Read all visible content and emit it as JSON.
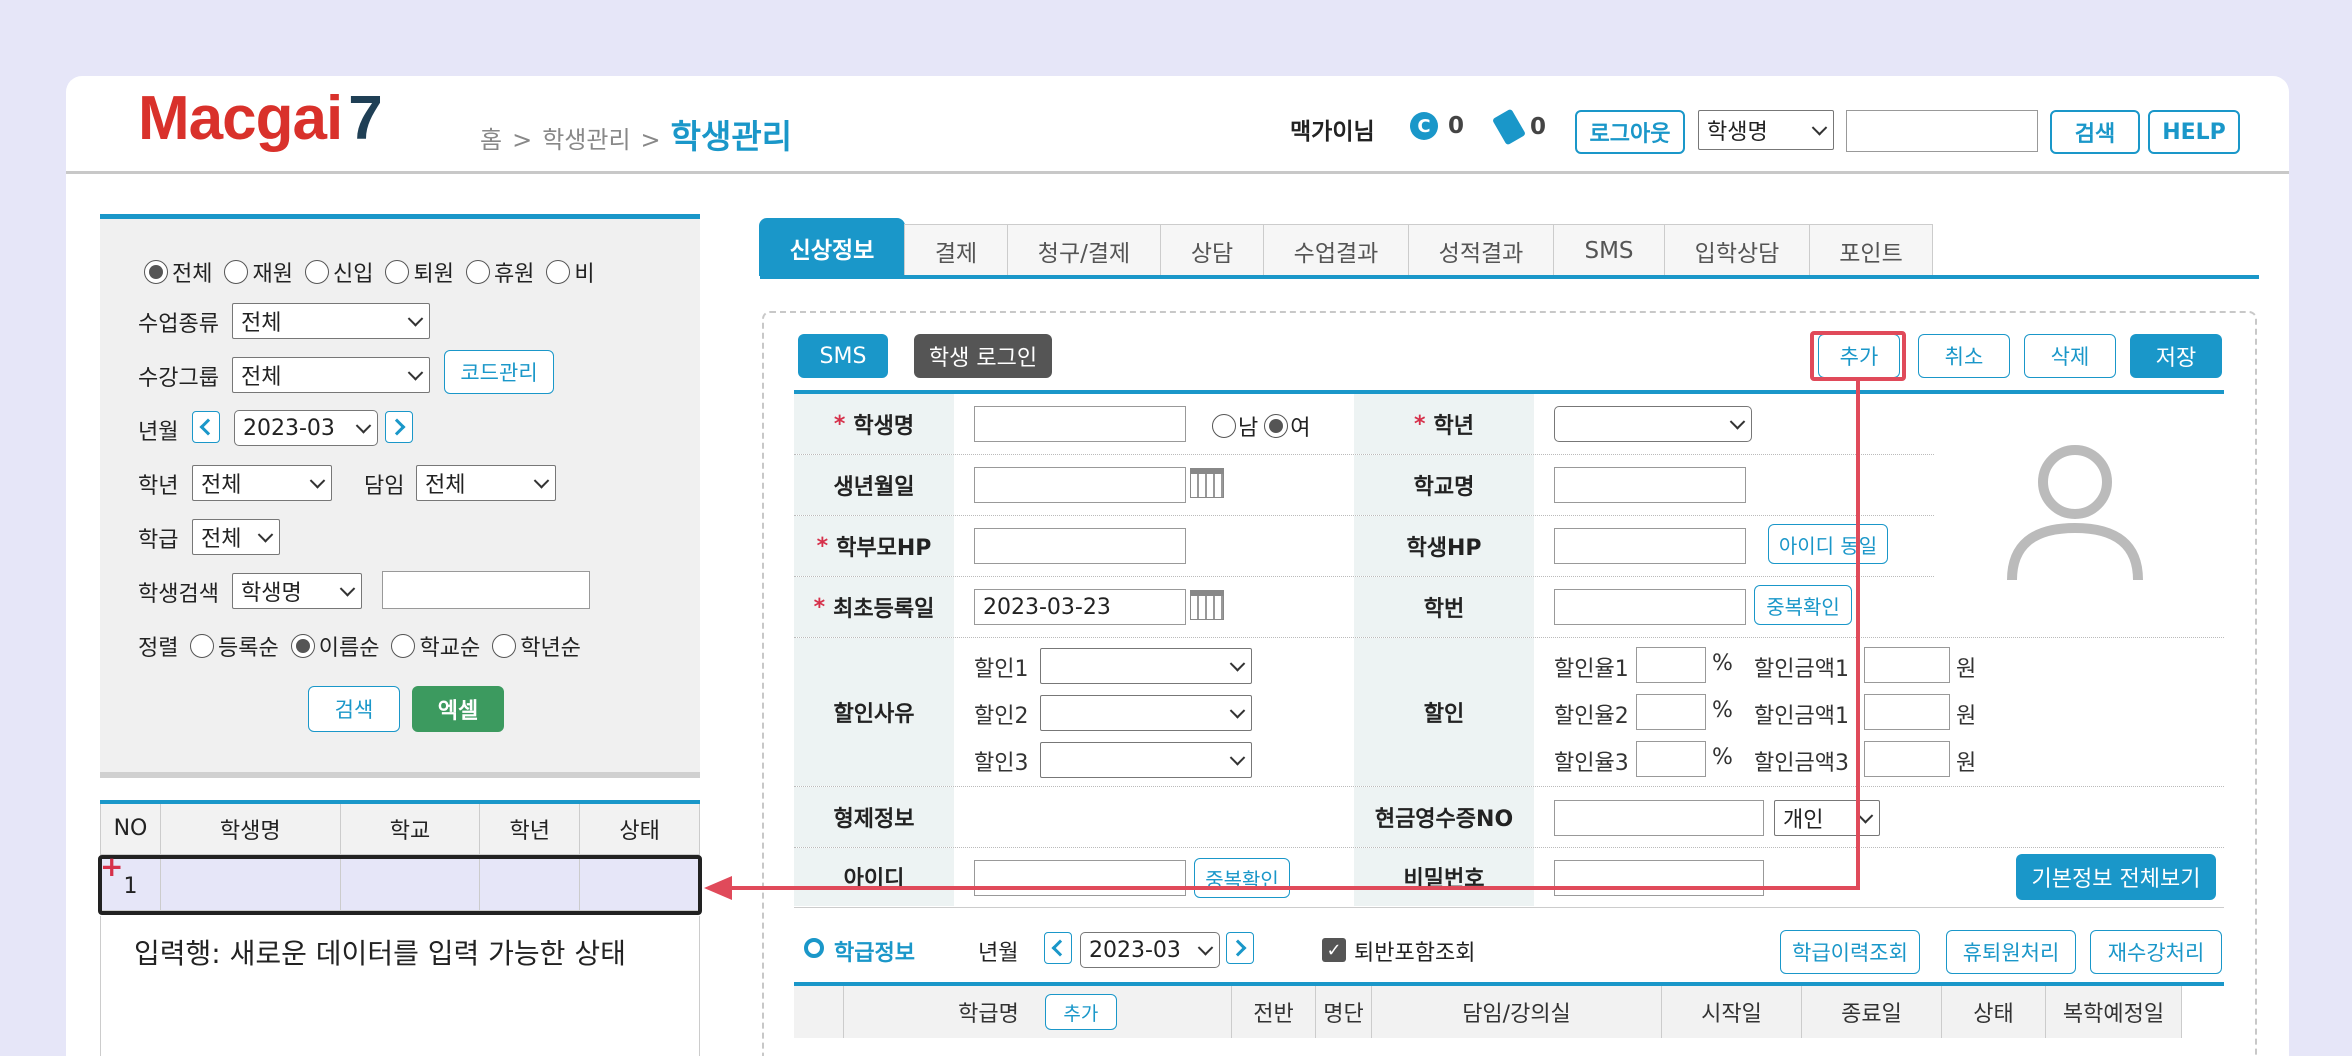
{
  "header": {
    "logo_main": "Macgai",
    "logo_num": "7",
    "breadcrumb": [
      "홈",
      ">",
      "학생관리",
      ">"
    ],
    "breadcrumb_current": "학생관리",
    "user_name": "맥가이님",
    "coin_count": "0",
    "ticket_count": "0",
    "logout_label": "로그아웃",
    "search_field_value": "학생명",
    "search_input_value": "",
    "search_label": "검색",
    "help_label": "HELP"
  },
  "left": {
    "status_options": [
      "전체",
      "재원",
      "신입",
      "퇴원",
      "휴원",
      "비"
    ],
    "status_selected": "전체",
    "class_type_label": "수업종류",
    "class_type_value": "전체",
    "group_label": "수강그룹",
    "group_value": "전체",
    "code_manage_label": "코드관리",
    "ym_label": "년월",
    "ym_value": "2023-03",
    "grade_label": "학년",
    "grade_value": "전체",
    "teacher_label": "담임",
    "teacher_value": "전체",
    "class_label": "학급",
    "class_value": "전체",
    "student_search_label": "학생검색",
    "student_search_field": "학생명",
    "student_search_input": "",
    "sort_label": "정렬",
    "sort_options": [
      "등록순",
      "이름순",
      "학교순",
      "학년순"
    ],
    "sort_selected": "이름순",
    "search_button": "검색",
    "excel_button": "엑셀",
    "table_headers": [
      "NO",
      "학생명",
      "학교",
      "학년",
      "상태"
    ],
    "rows": [
      [
        "1",
        "",
        "",
        "",
        ""
      ]
    ],
    "annotation": "입력행: 새로운 데이터를 입력 가능한 상태"
  },
  "tabs": [
    "신상정보",
    "결제",
    "청구/결제",
    "상담",
    "수업결과",
    "성적결과",
    "SMS",
    "입학상담",
    "포인트"
  ],
  "active_tab": "신상정보",
  "toolbar": {
    "sms": "SMS",
    "student_login": "학생 로그인",
    "add": "추가",
    "cancel": "취소",
    "delete": "삭제",
    "save": "저장"
  },
  "form": {
    "student_name_label": "학생명",
    "student_name_value": "",
    "gender_male": "남",
    "gender_female": "여",
    "gender_selected": "여",
    "grade_label": "학년",
    "grade_value": "",
    "birth_label": "생년월일",
    "birth_value": "",
    "school_label": "학교명",
    "school_value": "",
    "parent_hp_label": "학부모HP",
    "parent_hp_value": "",
    "student_hp_label": "학생HP",
    "student_hp_value": "",
    "id_same_label": "아이디 동일",
    "first_reg_label": "최초등록일",
    "first_reg_value": "2023-03-23",
    "student_no_label": "학번",
    "student_no_value": "",
    "dup_check_label": "중복확인",
    "discount_reason_label": "할인사유",
    "discount_items": [
      "할인1",
      "할인2",
      "할인3"
    ],
    "discount_label": "할인",
    "discount_rates": [
      "할인율1",
      "할인율2",
      "할인율3"
    ],
    "percent": "%",
    "discount_amounts": [
      "할인금액1",
      "할인금액1",
      "할인금액3"
    ],
    "won": "원",
    "sibling_label": "형제정보",
    "cash_receipt_label": "현금영수증NO",
    "cash_receipt_value": "",
    "cash_type_value": "개인",
    "id_label": "아이디",
    "id_value": "",
    "id_dup_check": "중복확인",
    "password_label": "비밀번호",
    "password_value": "",
    "basic_info_all": "기본정보 전체보기"
  },
  "class_info": {
    "title": "학급정보",
    "ym_label": "년월",
    "ym_value": "2023-03",
    "include_returned_label": "퇴반포함조회",
    "include_returned_checked": true,
    "history_button": "학급이력조회",
    "leave_button": "휴퇴원처리",
    "reenroll_button": "재수강처리",
    "headers": [
      "학급명",
      "추가",
      "전반",
      "명단",
      "담임/강의실",
      "시작일",
      "종료일",
      "상태",
      "복학예정일"
    ]
  },
  "colors": {
    "accent": "#1a97c9",
    "brand_red": "#d9312b",
    "highlight": "#e04a5a",
    "background": "#e6e6f8"
  }
}
